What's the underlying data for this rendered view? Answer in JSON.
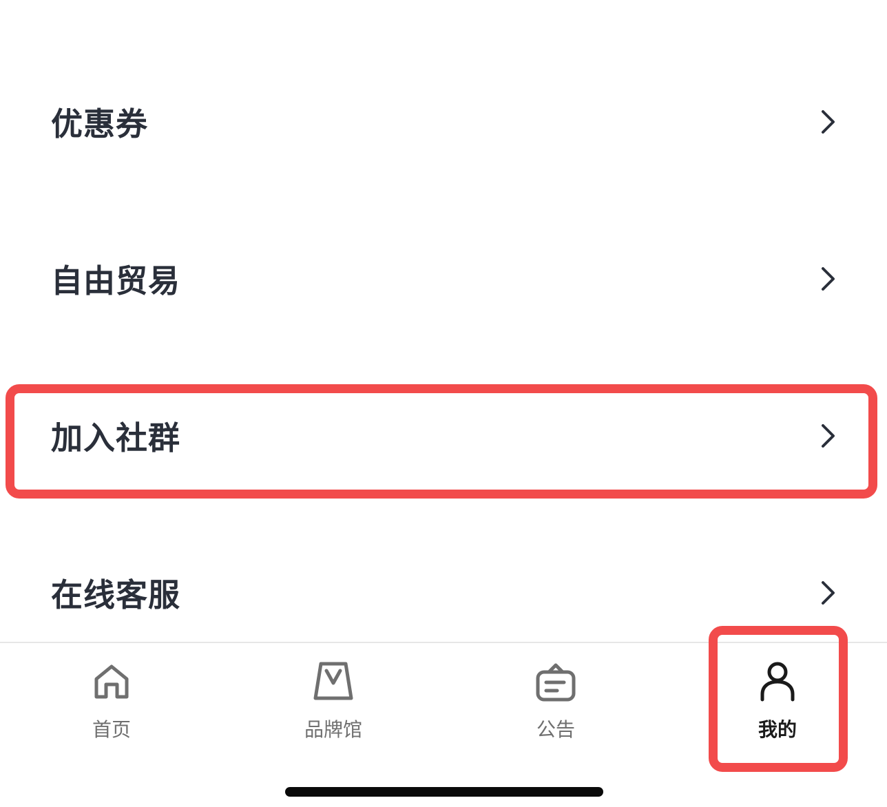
{
  "menu": {
    "items": [
      {
        "label": "优惠券"
      },
      {
        "label": "自由贸易"
      },
      {
        "label": "加入社群"
      },
      {
        "label": "在线客服"
      }
    ]
  },
  "tabbar": {
    "tabs": [
      {
        "label": "首页",
        "icon": "home-icon"
      },
      {
        "label": "品牌馆",
        "icon": "shopping-bag-icon"
      },
      {
        "label": "公告",
        "icon": "notice-board-icon"
      },
      {
        "label": "我的",
        "icon": "person-icon",
        "active": true
      }
    ]
  },
  "colors": {
    "text": "#2a2f3a",
    "highlight": "#f24b4b",
    "tab_inactive": "#6f6f6f",
    "tab_active": "#1a1a1a"
  }
}
